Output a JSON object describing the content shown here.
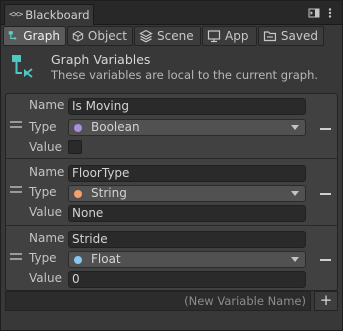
{
  "window": {
    "title": "Blackboard",
    "title_icon": "blackboard-icon"
  },
  "tabs": [
    {
      "label": "Graph",
      "icon": "graph-icon",
      "active": true
    },
    {
      "label": "Object",
      "icon": "cube-icon",
      "active": false
    },
    {
      "label": "Scene",
      "icon": "scene-icon",
      "active": false
    },
    {
      "label": "App",
      "icon": "app-icon",
      "active": false
    },
    {
      "label": "Saved",
      "icon": "folder-icon",
      "active": false
    }
  ],
  "header": {
    "title": "Graph Variables",
    "subtitle": "These variables are local to the current graph."
  },
  "labels": {
    "name": "Name",
    "type": "Type",
    "value": "Value"
  },
  "variables": [
    {
      "name": "Is Moving",
      "type": "Boolean",
      "type_color": "#a98ee0",
      "value_kind": "checkbox",
      "value": false
    },
    {
      "name": "FloorType",
      "type": "String",
      "type_color": "#f3a06a",
      "value_kind": "text",
      "value": "None"
    },
    {
      "name": "Stride",
      "type": "Float",
      "type_color": "#86c8f0",
      "value_kind": "text",
      "value": "0"
    }
  ],
  "footer": {
    "new_variable_placeholder": "(New Variable Name)",
    "add_label": "+"
  },
  "colors": {
    "background": "#383838",
    "accent_graph": "#4fc7c3"
  }
}
